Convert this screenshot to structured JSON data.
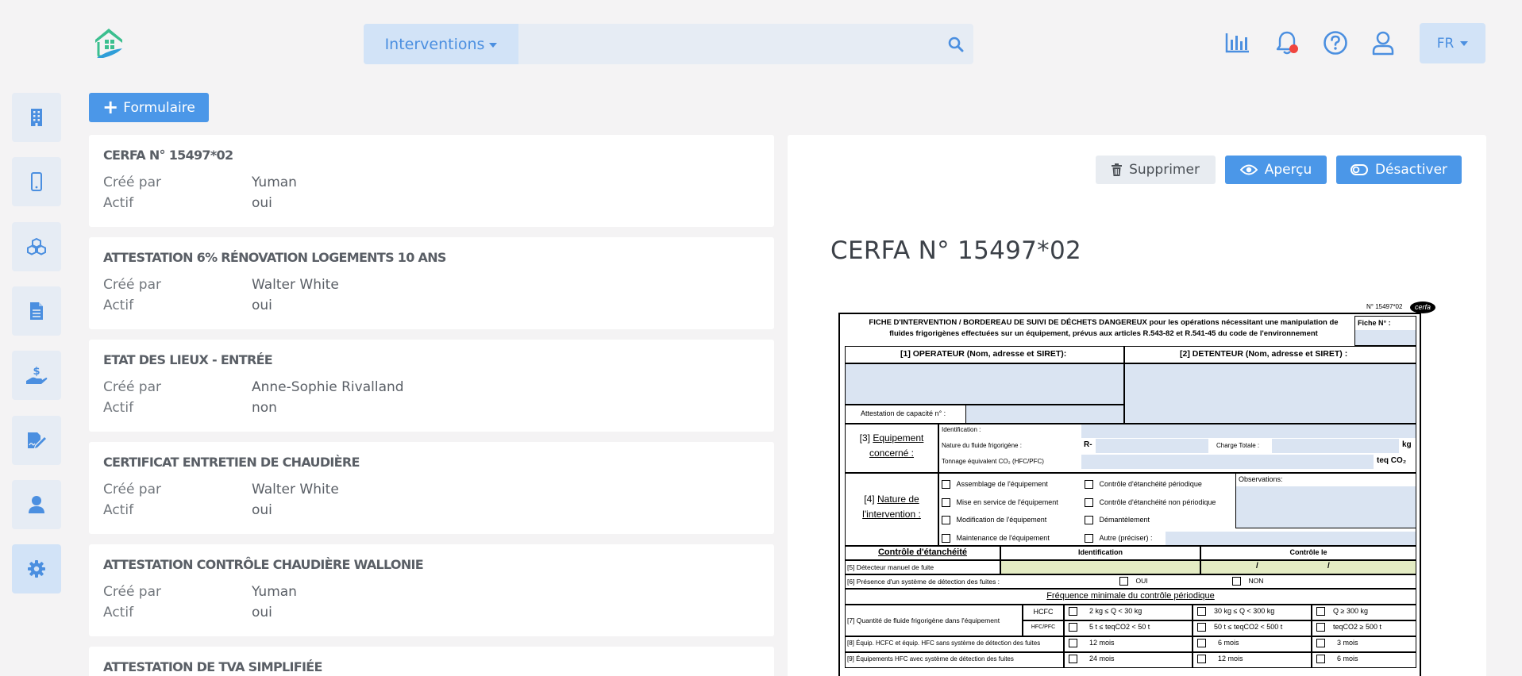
{
  "header": {
    "search_category": "Interventions",
    "search_placeholder": "",
    "language": "FR"
  },
  "sidebar": {
    "items": [
      {
        "icon": "building-icon"
      },
      {
        "icon": "mobile-icon"
      },
      {
        "icon": "cubes-icon"
      },
      {
        "icon": "document-icon"
      },
      {
        "icon": "hand-dollar-icon"
      },
      {
        "icon": "signature-icon"
      },
      {
        "icon": "user-icon"
      },
      {
        "icon": "gear-icon",
        "active": true
      }
    ]
  },
  "toolbar": {
    "add_form_label": "Formulaire"
  },
  "forms": [
    {
      "title": "CERFA N° 15497*02",
      "created_by_label": "Créé par",
      "created_by": "Yuman",
      "active_label": "Actif",
      "active": "oui"
    },
    {
      "title": "ATTESTATION 6% RÉNOVATION LOGEMENTS 10 ANS",
      "created_by_label": "Créé par",
      "created_by": "Walter White",
      "active_label": "Actif",
      "active": "oui"
    },
    {
      "title": "ETAT DES LIEUX - ENTRÉE",
      "created_by_label": "Créé par",
      "created_by": "Anne-Sophie Rivalland",
      "active_label": "Actif",
      "active": "non"
    },
    {
      "title": "CERTIFICAT ENTRETIEN DE CHAUDIÈRE",
      "created_by_label": "Créé par",
      "created_by": "Walter White",
      "active_label": "Actif",
      "active": "oui"
    },
    {
      "title": "ATTESTATION CONTRÔLE CHAUDIÈRE WALLONIE",
      "created_by_label": "Créé par",
      "created_by": "Yuman",
      "active_label": "Actif",
      "active": "oui"
    },
    {
      "title": "ATTESTATION DE TVA SIMPLIFIÉE",
      "created_by_label": "",
      "created_by": "",
      "active_label": "",
      "active": ""
    }
  ],
  "detail": {
    "delete_label": "Supprimer",
    "preview_label": "Aperçu",
    "deactivate_label": "Désactiver",
    "title": "CERFA N° 15497*02"
  },
  "preview": {
    "cerfa_no": "N° 15497*02",
    "cerfa_logo": "cerfa",
    "heading_bold": "FICHE D'INTERVENTION / BORDEREAU DE SUIVI DE DÉCHETS DANGEREUX",
    "heading_rest": " pour les opérations nécessitant une manipulation de",
    "heading_line2": "fluides frigorigènes effectuées sur un équipement, prévus aux articles R.543-82 et R.541-45 du code de l'environnement",
    "fiche_no": "Fiche N° :",
    "operateur": "[1] OPERATEUR (Nom, adresse et SIRET):",
    "detenteur": "[2] DETENTEUR  (Nom, adresse et SIRET) :",
    "attestation": "Attestation de capacité n° :",
    "equip_num": "[3]",
    "equip_label_1": "Equipement",
    "equip_label_2": "concerné :",
    "identification": "Identification :",
    "nature_fluide": "Nature du fluide frigorigène :",
    "r_prefix": "R-",
    "charge_totale": "Charge Totale :",
    "kg": "kg",
    "tonnage": "Tonnage équivalent CO₂ (HFC/PFC)",
    "teq": "teq CO₂",
    "nature_num": "[4]",
    "nature_label_1": "Nature de",
    "nature_label_2": "l'intervention :",
    "interventions_left": [
      "Assemblage de l'équipement",
      "Mise en service de l'équipement",
      "Modification de l'équipement",
      "Maintenance de l'équipement"
    ],
    "interventions_right": [
      "Contrôle d'étanchéité périodique",
      "Contrôle d'étanchéité non périodique",
      "Démantèlement",
      "Autre (préciser) :"
    ],
    "observations": "Observations:",
    "controle": "Contrôle d'étanchéité",
    "identification_col": "Identification",
    "controle_le": "Contrôle le",
    "detecteur": "[5] Détecteur manuel de fuite",
    "slash": "/",
    "presence": "[6] Présence d'un système de détection des fuites :",
    "oui": "OUI",
    "non": "NON",
    "frequence": "Fréquence minimale du contrôle périodique",
    "quantite": "[7] Quantité de fluide frigorigène dans l'équipement",
    "hcfc": "HCFC",
    "hfc_pfc": "HFC/PFC",
    "row_hcfc": [
      "2 kg ≤  Q < 30 kg",
      "30 kg ≤ Q < 300 kg",
      "Q  ≥ 300 kg"
    ],
    "row_hfc": [
      "5 t ≤ teqCO2 < 50 t",
      "50 t ≤ teqCO2 < 500 t",
      "teqCO2 ≥ 500 t"
    ],
    "row8_label": "[8] Équip. HCFC et équip. HFC sans système de détection des fuites",
    "row8": [
      "12 mois",
      "6 mois",
      "3 mois"
    ],
    "row9_label": "[9] Équipements HFC avec système de détection des fuites",
    "row9": [
      "24 mois",
      "12 mois",
      "6 mois"
    ]
  }
}
